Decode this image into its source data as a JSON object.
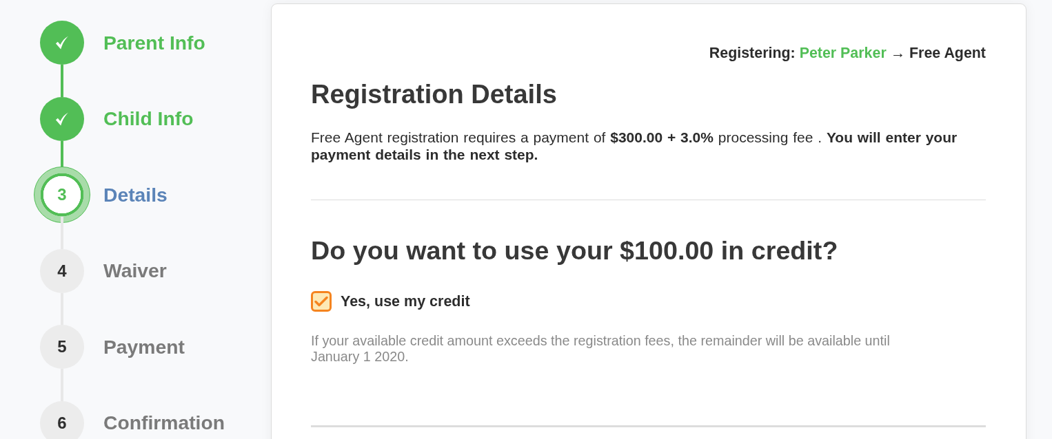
{
  "steps": [
    {
      "label": "Parent Info",
      "completed": true,
      "current": false
    },
    {
      "label": "Child Info",
      "completed": true,
      "current": false
    },
    {
      "number": "3",
      "label": "Details",
      "completed": false,
      "current": true
    },
    {
      "number": "4",
      "label": "Waiver",
      "completed": false,
      "current": false
    },
    {
      "number": "5",
      "label": "Payment",
      "completed": false,
      "current": false
    },
    {
      "number": "6",
      "label": "Confirmation",
      "completed": false,
      "current": false
    }
  ],
  "registering": {
    "label": "Registering:",
    "name": "Peter Parker",
    "destination": "→ Free Agent"
  },
  "details": {
    "title": "Registration Details",
    "description": "Free Agent registration requires a payment of **$300.00 + 3.0%** processing fee . **You will enter your payment details in the next step.**"
  },
  "credit": {
    "question": "Do you want to use your $100.00 in credit?",
    "option": {
      "label": "Yes, use my credit",
      "checked": true
    },
    "note": "If your available credit amount exceeds the registration fees, the remainder will be available until January 1 2020."
  }
}
